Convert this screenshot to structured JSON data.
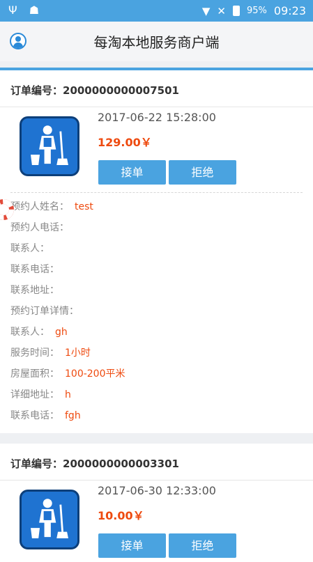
{
  "status_bar": {
    "left_icons": [
      "usb-icon",
      "android-icon"
    ],
    "wifi_icon": "wifi-icon",
    "signal_icon": "no-signal-icon",
    "battery_percent": "95%",
    "time": "09:23"
  },
  "app_bar": {
    "title": "每淘本地服务商户端",
    "profile_icon": "user-icon"
  },
  "colors": {
    "accent": "#4aa3e0",
    "price": "#ee4a0f",
    "icon_blue": "#1f73d1"
  },
  "orders": [
    {
      "order_number": "订单编号：2000000000007501",
      "datetime": "2017-06-22 15:28:00",
      "price": "129.00￥",
      "accept_label": "接单",
      "reject_label": "拒绝",
      "details": [
        {
          "label": "预约人姓名：",
          "value": "test"
        },
        {
          "label": "预约人电话：",
          "value": ""
        },
        {
          "label": "联系人：",
          "value": ""
        },
        {
          "label": "联系电话：",
          "value": ""
        },
        {
          "label": "联系地址：",
          "value": ""
        },
        {
          "label": "预约订单详情：",
          "value": ""
        },
        {
          "label": "联系人：",
          "value": "gh"
        },
        {
          "label": "服务时间：",
          "value": "1小时"
        },
        {
          "label": "房屋面积：",
          "value": "100-200平米"
        },
        {
          "label": "详细地址：",
          "value": "h"
        },
        {
          "label": "联系电话：",
          "value": "fgh"
        }
      ]
    },
    {
      "order_number": "订单编号：2000000000003301",
      "datetime": "2017-06-30 12:33:00",
      "price": "10.00￥",
      "accept_label": "接单",
      "reject_label": "拒绝"
    }
  ]
}
